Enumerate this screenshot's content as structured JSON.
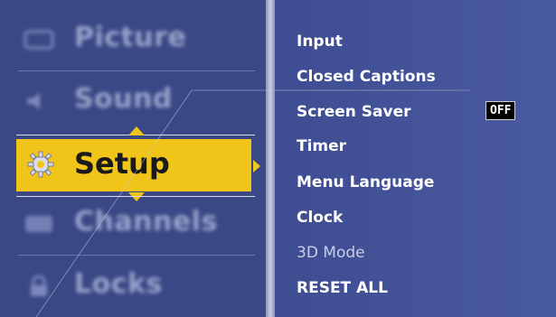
{
  "left_menu": {
    "items": [
      {
        "label": "Picture",
        "icon": "picture-icon"
      },
      {
        "label": "Sound",
        "icon": "speaker-icon"
      },
      {
        "label": "Setup",
        "icon": "gear-icon"
      },
      {
        "label": "Channels",
        "icon": "tv-icon"
      },
      {
        "label": "Locks",
        "icon": "lock-icon"
      }
    ],
    "selected": "Setup"
  },
  "setup_submenu": {
    "items": [
      {
        "label": "Input"
      },
      {
        "label": "Closed Captions"
      },
      {
        "label": "Screen Saver",
        "value": "OFF"
      },
      {
        "label": "Timer"
      },
      {
        "label": "Menu Language"
      },
      {
        "label": "Clock"
      },
      {
        "label": "3D Mode"
      },
      {
        "label": "RESET ALL"
      }
    ]
  },
  "colors": {
    "highlight": "#f0c418",
    "panel_bg": "#3e4d92"
  }
}
